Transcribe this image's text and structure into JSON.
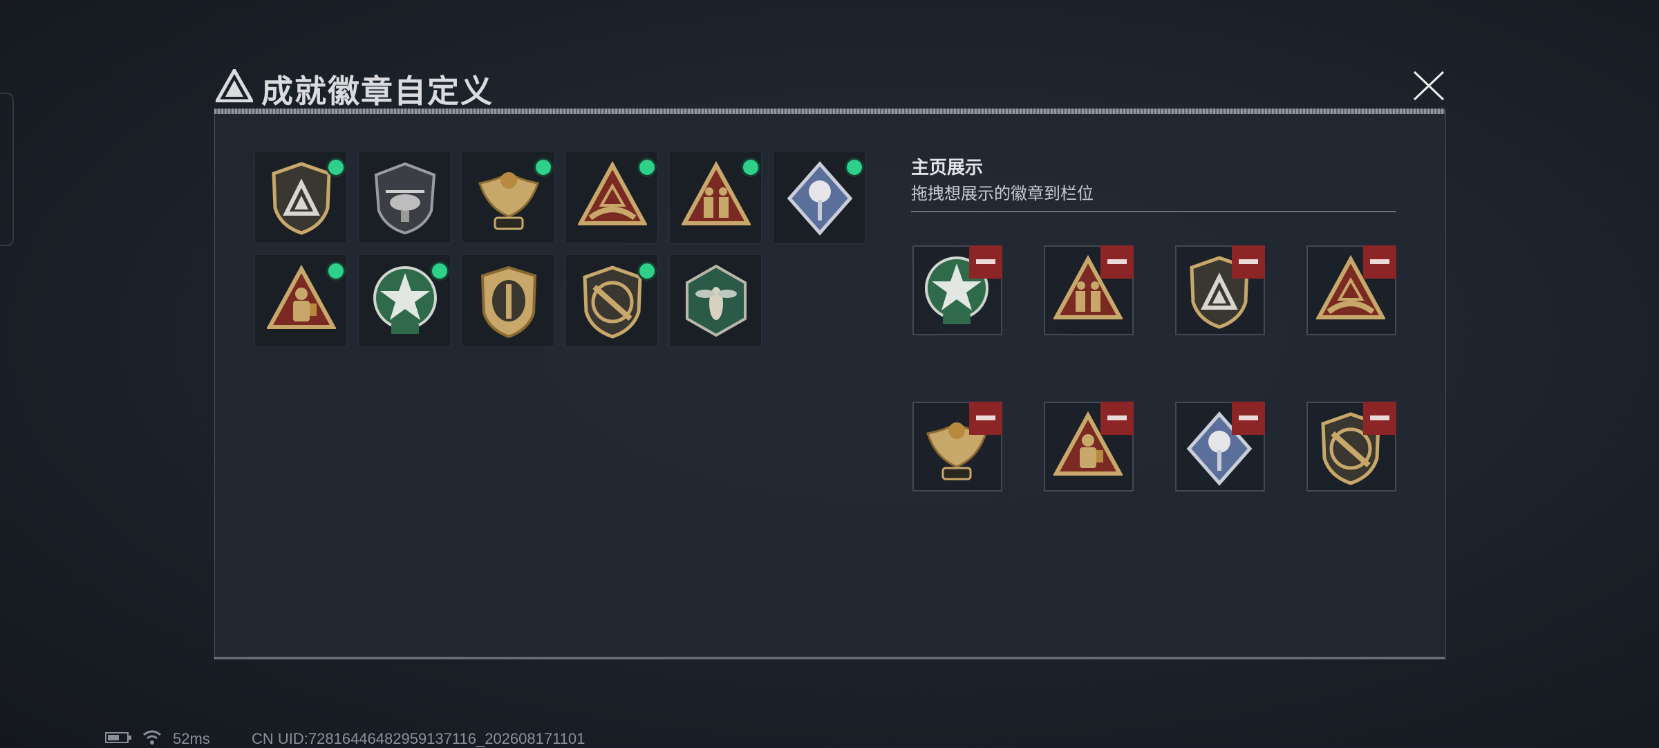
{
  "dialog": {
    "title": "成就徽章自定义",
    "close_icon": "close-icon"
  },
  "badges": [
    {
      "icon": "shield-triangle-badge",
      "equipped": true
    },
    {
      "icon": "helicopter-badge",
      "equipped": false
    },
    {
      "icon": "eagle-wings-badge",
      "equipped": true
    },
    {
      "icon": "triangle-hands-badge",
      "equipped": true
    },
    {
      "icon": "triangle-soldiers-badge",
      "equipped": true
    },
    {
      "icon": "rose-diamond-badge",
      "equipped": true
    },
    {
      "icon": "triangle-hazmat-badge",
      "equipped": true
    },
    {
      "icon": "green-star-badge",
      "equipped": true
    },
    {
      "icon": "shield-arrows-badge",
      "equipped": false
    },
    {
      "icon": "shield-knife-badge",
      "equipped": true
    },
    {
      "icon": "hexagon-wasp-badge",
      "equipped": false
    }
  ],
  "showcase": {
    "title": "主页展示",
    "subtitle": "拖拽想展示的徽章到栏位",
    "slots": [
      {
        "icon": "green-star-badge"
      },
      {
        "icon": "triangle-soldiers-badge"
      },
      {
        "icon": "shield-triangle-badge"
      },
      {
        "icon": "triangle-hands-badge"
      },
      {
        "icon": "eagle-wings-badge"
      },
      {
        "icon": "triangle-hazmat-badge"
      },
      {
        "icon": "rose-diamond-badge"
      },
      {
        "icon": "shield-knife-badge"
      }
    ]
  },
  "status": {
    "ping": "52ms",
    "uid": "CN UID:7281644648295913​7116_202608171101"
  },
  "colors": {
    "accent_green": "#2ed08a",
    "remove_red": "#8c2525",
    "gold": "#c8a86a"
  }
}
